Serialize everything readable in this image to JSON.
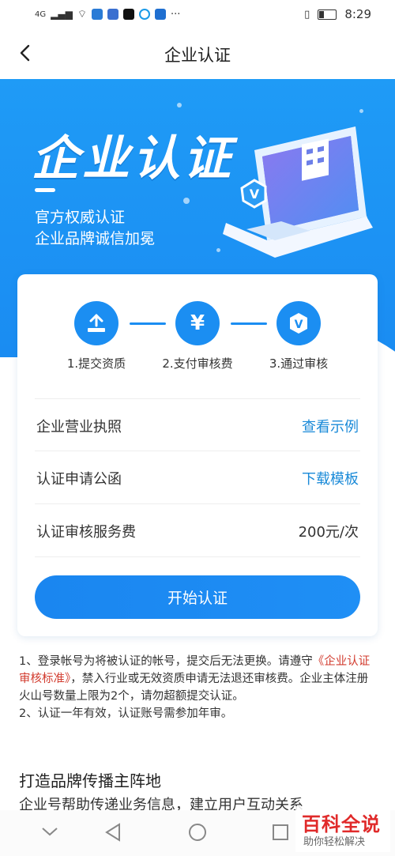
{
  "status_bar": {
    "network": "4G",
    "time": "8:29"
  },
  "nav": {
    "title": "企业认证"
  },
  "hero": {
    "title": "企业认证",
    "line1": "官方权威认证",
    "line2": "企业品牌诚信加冕",
    "badge": "V"
  },
  "steps": [
    {
      "label": "1.提交资质",
      "icon": "upload-icon"
    },
    {
      "label": "2.支付审核费",
      "icon": "yen-icon",
      "glyph": "¥"
    },
    {
      "label": "3.通过审核",
      "icon": "verified-icon",
      "glyph": "V"
    }
  ],
  "rows": [
    {
      "label": "企业营业执照",
      "action": "查看示例"
    },
    {
      "label": "认证申请公函",
      "action": "下载模板"
    },
    {
      "label": "认证审核服务费",
      "value": "200元/次"
    }
  ],
  "start_button": "开始认证",
  "notes": {
    "p1_a": "1、登录帐号为将被认证的帐号，提交后无法更换。请遵守",
    "p1_link": "《企业认证审核标准》",
    "p1_b": "，禁入行业或无效资质申请无法退还审核费。企业主体注册火山号数量上限为2个，请勿超额提交认证。",
    "p2": "2、认证一年有效，认证账号需参加年审。"
  },
  "section": {
    "title": "打造品牌传播主阵地",
    "desc": "企业号帮助传递业务信息，建立用户互动关系"
  },
  "watermark": {
    "title": "百科全说",
    "subtitle": "助你轻松解决"
  },
  "colors": {
    "primary": "#1b8ef2",
    "link": "#1a8ad8",
    "highlight": "#d23b2e"
  }
}
